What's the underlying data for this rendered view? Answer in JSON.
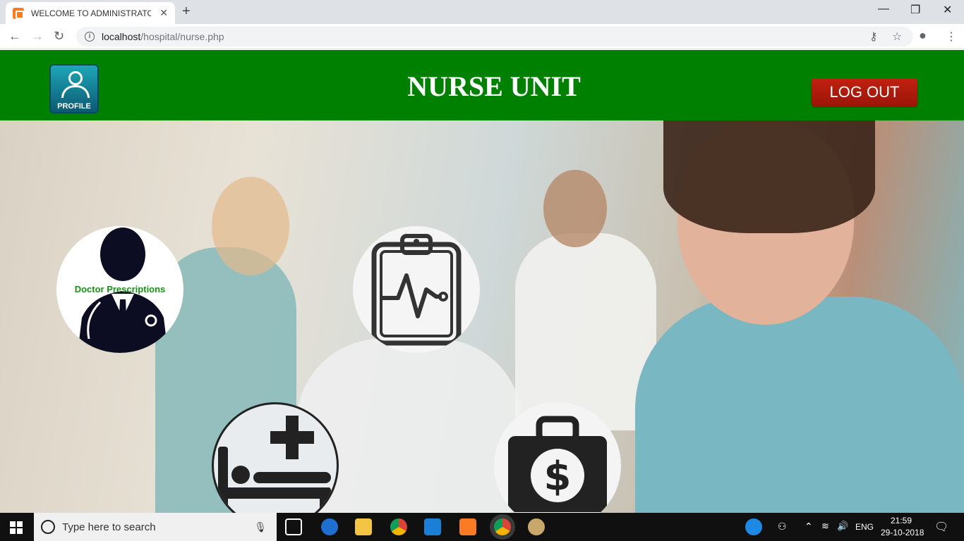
{
  "browser": {
    "tab_title": "WELCOME TO ADMINISTRATOR U",
    "url_host": "localhost",
    "url_path": "/hospital/nurse.php"
  },
  "header": {
    "profile_label": "PROFILE",
    "title": "NURSE UNIT",
    "logout_label": "LOG OUT",
    "color": "#008000"
  },
  "menu": {
    "doctor_prescriptions_label": "Doctor Prescriptions"
  },
  "taskbar": {
    "search_placeholder": "Type here to search",
    "language": "ENG",
    "time": "21:59",
    "date": "29-10-2018"
  }
}
